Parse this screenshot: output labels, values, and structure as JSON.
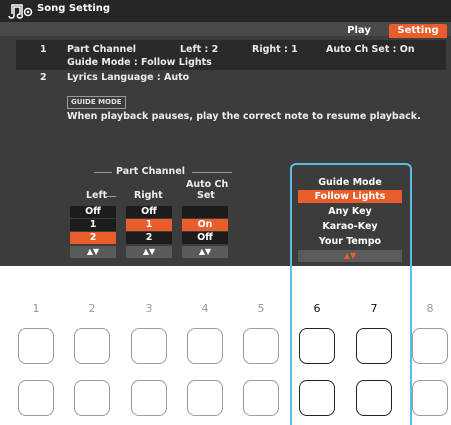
{
  "app": {
    "title": "Song Setting"
  },
  "tabs": {
    "play": "Play",
    "setting": "Setting"
  },
  "list": {
    "row1": {
      "index": "1",
      "label": "Part Channel",
      "left": "Left : 2",
      "right": "Right : 1",
      "auto": "Auto Ch Set : On",
      "guide": "Guide Mode : Follow Lights"
    },
    "row2": {
      "index": "2",
      "label": "Lyrics Language : Auto"
    }
  },
  "guide_badge": "GUIDE MODE",
  "description": "When playback pauses, play the correct note to resume playback.",
  "part_channel": {
    "header": "Part Channel",
    "left": {
      "label": "Left",
      "items": [
        "Off",
        "1",
        "2"
      ],
      "selected": 2,
      "arrows": "▲▼"
    },
    "right": {
      "label": "Right",
      "items": [
        "Off",
        "1",
        "2"
      ],
      "selected": 1,
      "arrows": "▲▼"
    },
    "auto": {
      "label_line1": "Auto Ch",
      "label_line2": "Set",
      "items": [
        "On",
        "Off"
      ],
      "selected": 0,
      "arrows": "▲▼"
    }
  },
  "guide_mode": {
    "header": "Guide Mode",
    "items": [
      "Follow Lights",
      "Any Key",
      "Karao-Key",
      "Your Tempo"
    ],
    "selected": 0,
    "arrows": "▲▼"
  },
  "buttons": {
    "numbers": [
      "1",
      "2",
      "3",
      "4",
      "5",
      "6",
      "7",
      "8"
    ],
    "highlighted": [
      "6",
      "7"
    ]
  },
  "colors": {
    "accent": "#e85d2a",
    "highlight_frame": "#5bbce4",
    "lcd_bg": "#3c3c3c"
  }
}
